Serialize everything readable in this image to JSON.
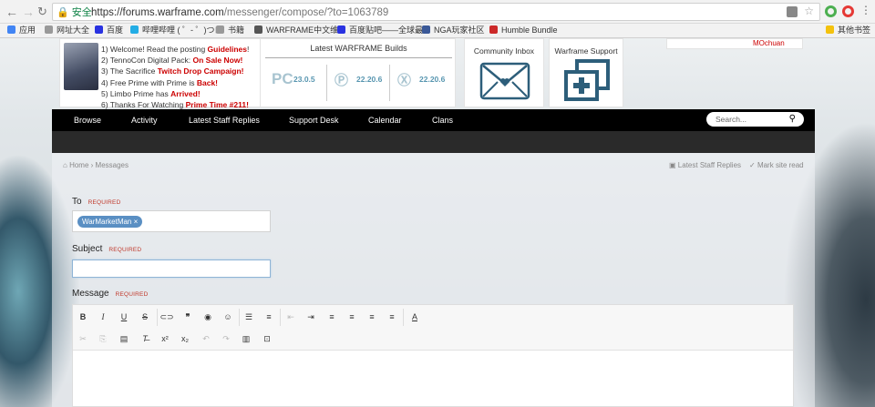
{
  "browser": {
    "secure_label": "安全",
    "url_host": "https://forums.warframe.com",
    "url_path": "/messenger/compose/?to=1063789"
  },
  "bookmarks": [
    {
      "label": "应用",
      "color": "#4285f4"
    },
    {
      "label": "网址大全",
      "color": "#999999"
    },
    {
      "label": "百度",
      "color": "#2932e1"
    },
    {
      "label": "哔哩哔哩 ( ゜- ゜)つロ",
      "color": "#23ade5"
    },
    {
      "label": "书籍",
      "color": "#999999"
    },
    {
      "label": "WARFRAME中文维",
      "color": "#555555"
    },
    {
      "label": "百度贴吧——全球最",
      "color": "#2932e1"
    },
    {
      "label": "NGA玩家社区",
      "color": "#3b5998"
    },
    {
      "label": "Humble Bundle",
      "color": "#cc2929"
    },
    {
      "label": "其他书签",
      "color": "#f4c20d"
    }
  ],
  "header": {
    "news": [
      {
        "text": "1) Welcome! Read the posting ",
        "highlight": "Guidelines",
        "suffix": "!"
      },
      {
        "text": "2) TennoCon Digital Pack: ",
        "highlight": "On Sale Now!",
        "suffix": ""
      },
      {
        "text": "3) The Sacrifice ",
        "highlight": "Twitch Drop Campaign!",
        "suffix": ""
      },
      {
        "text": "4) Free Prime with Prime is ",
        "highlight": "Back!",
        "suffix": ""
      },
      {
        "text": "5) Limbo Prime has ",
        "highlight": "Arrived!",
        "suffix": ""
      },
      {
        "text": "6) Thanks For Watching ",
        "highlight": "Prime Time #211!",
        "suffix": ""
      }
    ],
    "builds_title": "Latest WARFRAME Builds",
    "builds": [
      {
        "platform": "PC",
        "version": "23.0.5"
      },
      {
        "platform": "PS",
        "version": "22.20.6"
      },
      {
        "platform": "XB",
        "version": "22.20.6"
      }
    ],
    "inbox_title": "Community Inbox",
    "support_title": "Warframe Support",
    "username": "MOchuan"
  },
  "nav": {
    "items": [
      "Browse",
      "Activity",
      "Latest Staff Replies",
      "Support Desk",
      "Calendar",
      "Clans"
    ],
    "search_placeholder": "Search..."
  },
  "breadcrumb": {
    "home": "Home",
    "current": "Messages",
    "staff_replies": "Latest Staff Replies",
    "mark_read": "Mark site read"
  },
  "form": {
    "to_label": "To",
    "required": "REQUIRED",
    "recipient": "WarMarketMan",
    "subject_label": "Subject",
    "subject_value": "",
    "message_label": "Message"
  },
  "colors": {
    "accent": "#5a8fc3",
    "required": "#c0392b",
    "news_highlight": "#cc0000",
    "build_version": "#5896b0"
  }
}
